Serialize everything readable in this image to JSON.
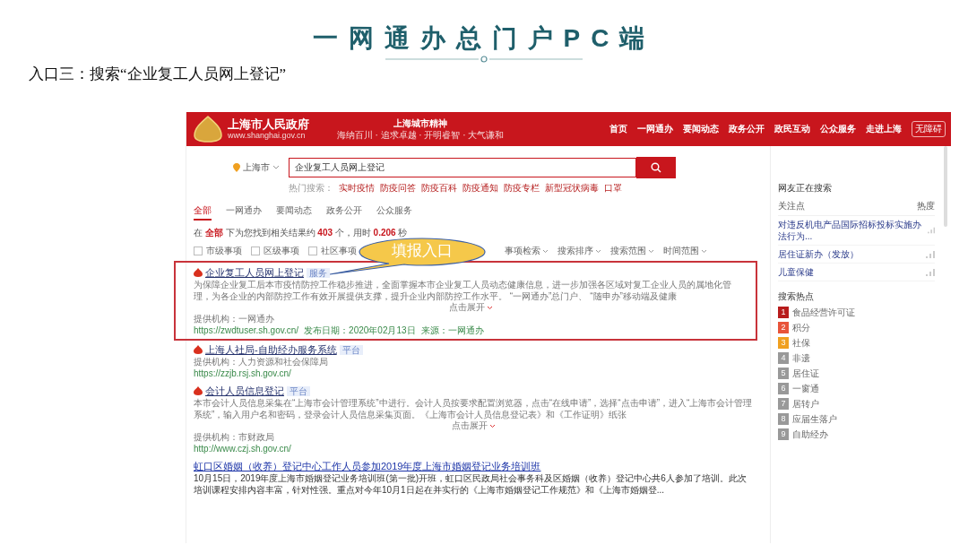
{
  "slide": {
    "title": "一网通办总门户PC端",
    "subtitle": "入口三：搜索“企业复工人员网上登记”"
  },
  "header": {
    "site_name": "上海市人民政府",
    "site_url": "www.shanghai.gov.cn",
    "motto_title": "上海城市精神",
    "motto": "海纳百川 · 追求卓越 · 开明睿智 · 大气谦和",
    "nav": [
      {
        "label": "首页"
      },
      {
        "label": "一网通办"
      },
      {
        "label": "要闻动态"
      },
      {
        "label": "政务公开"
      },
      {
        "label": "政民互动"
      },
      {
        "label": "公众服务"
      },
      {
        "label": "走进上海"
      }
    ],
    "accessibility": "无障碍"
  },
  "search": {
    "location": "上海市",
    "value": "企业复工人员网上登记",
    "hot_label": "热门搜索：",
    "hot": [
      "实时疫情",
      "防疫问答",
      "防疫百科",
      "防疫通知",
      "防疫专栏",
      "新型冠状病毒",
      "口罩"
    ]
  },
  "tabs": [
    {
      "label": "全部",
      "selected": true
    },
    {
      "label": "一网通办",
      "selected": false
    },
    {
      "label": "要闻动态",
      "selected": false
    },
    {
      "label": "政务公开",
      "selected": false
    },
    {
      "label": "公众服务",
      "selected": false
    }
  ],
  "summary": "在 **全部** 下为您找到相关结果约 **403** 个，用时 **0.206** 秒",
  "filters": {
    "checkboxes": [
      {
        "label": "市级事项",
        "checked": false
      },
      {
        "label": "区级事项",
        "checked": false
      },
      {
        "label": "社区事项",
        "checked": false
      }
    ],
    "dropdowns": [
      "事项检索",
      "搜索排序",
      "搜索范围",
      "时间范围"
    ]
  },
  "callout": "填报入口",
  "results": [
    {
      "kind": "item",
      "title": "企业复工人员网上登记",
      "tag": "服务",
      "highlighted": true,
      "description": "为保障企业复工后本市疫情防控工作稳步推进，全面掌握本市企业复工人员动态健康信息，进一步加强各区域对复工企业人员的属地化管理，为各企业的内部防控工作有效开展提供支撑，提升企业内部防控工作水平。 “一网通办”总门户、 “随申办”移动端及健康",
      "expand": "点击展开",
      "provider": "提供机构：一网通办",
      "url": "https://zwdtuser.sh.gov.cn/",
      "date": "发布日期：2020年02月13日",
      "source": "来源：一网通办"
    },
    {
      "kind": "item",
      "title": "上海人社局-自助经办服务系统",
      "tag": "平台",
      "highlighted": false,
      "provider": "提供机构：人力资源和社会保障局",
      "url": "https://zzjb.rsj.sh.gov.cn/"
    },
    {
      "kind": "item",
      "title": "会计人员信息登记",
      "tag": "平台",
      "highlighted": false,
      "description": "本市会计人员信息采集在“上海市会计管理系统”中进行。会计人员按要求配置浏览器，点击“在线申请”，选择“点击申请”，进入“上海市会计管理系统”，输入用户名和密码，登录会计人员信息采集页面。《上海市会计人员信息登记表》和《工作证明》纸张",
      "expand": "点击展开",
      "provider": "提供机构：市财政局",
      "url": "http://www.czj.sh.gov.cn/"
    },
    {
      "kind": "news",
      "title": "虹口区婚姻（收养）登记中心工作人员参加2019年度上海市婚姻登记业务培训班",
      "highlighted": false,
      "description": "10月15日，2019年度上海市婚姻登记业务培训班(第一批)开班，虹口区民政局社会事务科及区婚姻（收养）登记中心共6人参加了培训。此次培训课程安排内容丰富，针对性强。重点对今年10月1日起在并实行的《上海市婚姻登记工作规范》和《上海市婚姻登..."
    }
  ],
  "sidebar": {
    "title": "网友正在搜索",
    "col_topic": "关注点",
    "col_heat": "热度",
    "trending": [
      "对违反机电产品国际招标投标实施办法行为...",
      "居住证新办（发放）",
      "儿童保健"
    ],
    "hot_title": "搜索热点",
    "hot": [
      {
        "rank": "1",
        "label": "食品经营许可证",
        "color": "#b81c1c"
      },
      {
        "rank": "2",
        "label": "积分",
        "color": "#e8543a"
      },
      {
        "rank": "3",
        "label": "社保",
        "color": "#f0a020"
      },
      {
        "rank": "4",
        "label": "非遗",
        "color": "#999999"
      },
      {
        "rank": "5",
        "label": "居住证",
        "color": "#999999"
      },
      {
        "rank": "6",
        "label": "一窗通",
        "color": "#999999"
      },
      {
        "rank": "7",
        "label": "居转户",
        "color": "#999999"
      },
      {
        "rank": "8",
        "label": "应届生落户",
        "color": "#999999"
      },
      {
        "rank": "9",
        "label": "自助经办",
        "color": "#999999"
      }
    ]
  }
}
